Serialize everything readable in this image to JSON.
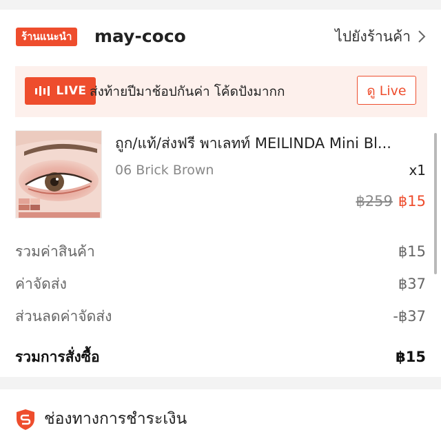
{
  "store": {
    "badge": "ร้านแนะนำ",
    "name": "may-coco",
    "visit_label": "ไปยังร้านค้า"
  },
  "live": {
    "tag_label": "LIVE",
    "title": "ส่งท้ายปีมาช้อปกันค่า โค้ดปังมากก",
    "watch_label": "ดู Live"
  },
  "product": {
    "name": "ถูก/แท้/ส่งฟรี พาเลทท์ MEILINDA Mini Bl...",
    "variant": "06 Brick Brown",
    "quantity": "x1",
    "original_price": "฿259",
    "sale_price": "฿15"
  },
  "summary": {
    "rows": [
      {
        "label": "รวมค่าสินค้า",
        "value": "฿15"
      },
      {
        "label": "ค่าจัดส่ง",
        "value": "฿37"
      },
      {
        "label": "ส่วนลดค่าจัดส่ง",
        "value": "-฿37"
      }
    ],
    "total": {
      "label": "รวมการสั่งซื้อ",
      "value": "฿15"
    }
  },
  "payment": {
    "label": "ช่องทางการชำระเงิน"
  },
  "colors": {
    "accent": "#ee4d2d",
    "live_banner_bg": "#fdf0ec"
  },
  "icons": {
    "live": "live-bars-icon",
    "chevron": "chevron-right-icon",
    "payment": "shield-s-icon"
  }
}
